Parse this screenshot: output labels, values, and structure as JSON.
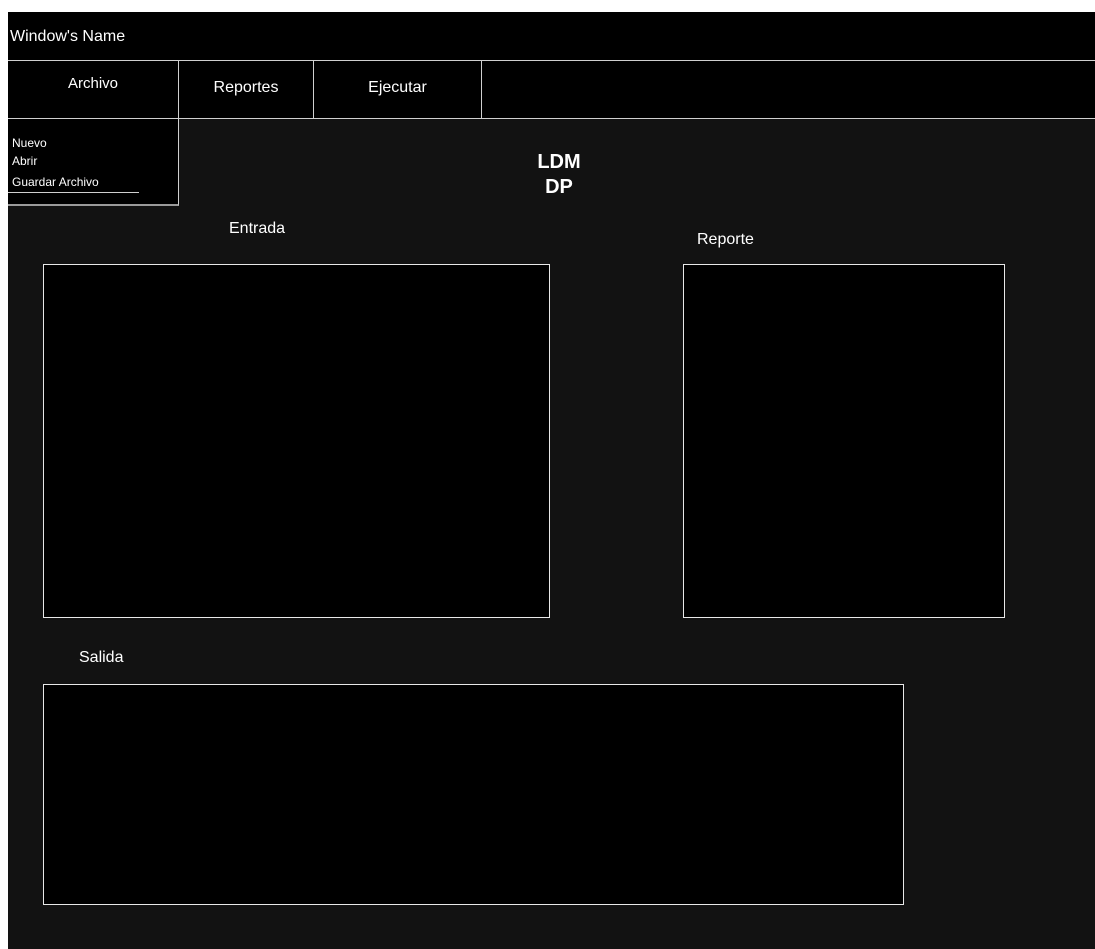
{
  "window": {
    "title": "Window's Name"
  },
  "menubar": {
    "tabs": [
      {
        "label": "Archivo"
      },
      {
        "label": "Reportes"
      },
      {
        "label": "Ejecutar"
      }
    ]
  },
  "dropdown": {
    "items": [
      {
        "label": "Nuevo"
      },
      {
        "label": "Abrir"
      },
      {
        "label": "Guardar Archivo"
      }
    ]
  },
  "header": {
    "line1": "LDM",
    "line2": "DP"
  },
  "sections": {
    "entrada_label": "Entrada",
    "reporte_label": "Reporte",
    "salida_label": "Salida"
  },
  "colors": {
    "window_background": "#121212",
    "panel_background": "#000000",
    "border": "#e8e8e8",
    "text": "#ffffff"
  }
}
